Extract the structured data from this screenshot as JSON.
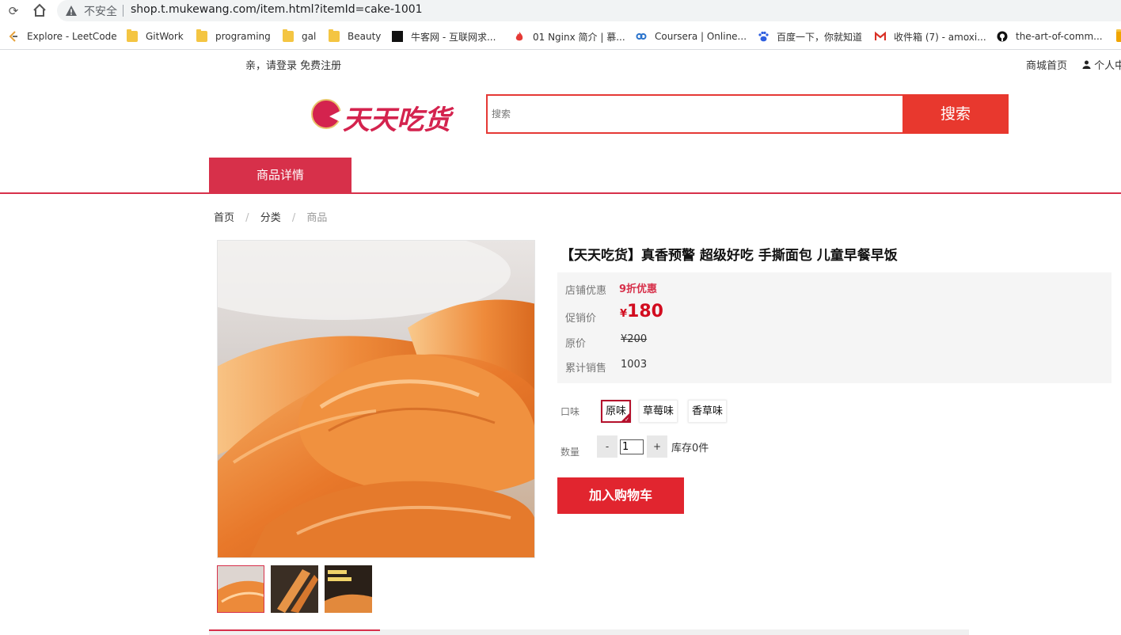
{
  "browser": {
    "insecure_label": "不安全",
    "url": "shop.t.mukewang.com/item.html?itemId=cake-1001",
    "bookmarks": [
      {
        "label": "Explore - LeetCode",
        "icon": "leetcode-icon"
      },
      {
        "label": "GitWork",
        "icon": "folder-icon"
      },
      {
        "label": "programing",
        "icon": "folder-icon"
      },
      {
        "label": "gal",
        "icon": "folder-icon"
      },
      {
        "label": "Beauty",
        "icon": "folder-icon"
      },
      {
        "label": "牛客网 - 互联网求...",
        "icon": "nowcoder-icon"
      },
      {
        "label": "01 Nginx 简介 | 慕...",
        "icon": "fire-icon"
      },
      {
        "label": "Coursera | Online...",
        "icon": "coursera-icon"
      },
      {
        "label": "百度一下，你就知道",
        "icon": "baidu-paw-icon"
      },
      {
        "label": "收件箱 (7) - amoxi...",
        "icon": "gmail-icon"
      },
      {
        "label": "the-art-of-comm...",
        "icon": "github-icon"
      }
    ]
  },
  "header": {
    "login_prompt": "亲，请登录",
    "register": "免费注册",
    "mall_home": "商城首页",
    "personal": "个人中",
    "logo_text": "天天吃货",
    "search_placeholder": "搜索",
    "search_button": "搜索",
    "tab_detail": "商品详情"
  },
  "breadcrumb": [
    "首页",
    "分类",
    "商品"
  ],
  "product": {
    "title": "【天天吃货】真香预警 超级好吃 手撕面包 儿童早餐早饭",
    "store_promo_label": "店铺优惠",
    "store_promo_value": "9折优惠",
    "promo_price_label": "促销价",
    "currency": "¥",
    "promo_price": "180",
    "original_price_label": "原价",
    "original_price": "¥200",
    "sales_label": "累计销售",
    "sales_value": "1003",
    "flavor_label": "口味",
    "flavors": [
      "原味",
      "草莓味",
      "香草味"
    ],
    "quantity_label": "数量",
    "qty_minus": "-",
    "qty_plus": "+",
    "quantity": "1",
    "stock_text": "库存0件",
    "add_to_cart": "加入购物车"
  },
  "colors": {
    "brand_red": "#d7304a",
    "price_red": "#d20c1f",
    "search_red": "#e8382e"
  }
}
